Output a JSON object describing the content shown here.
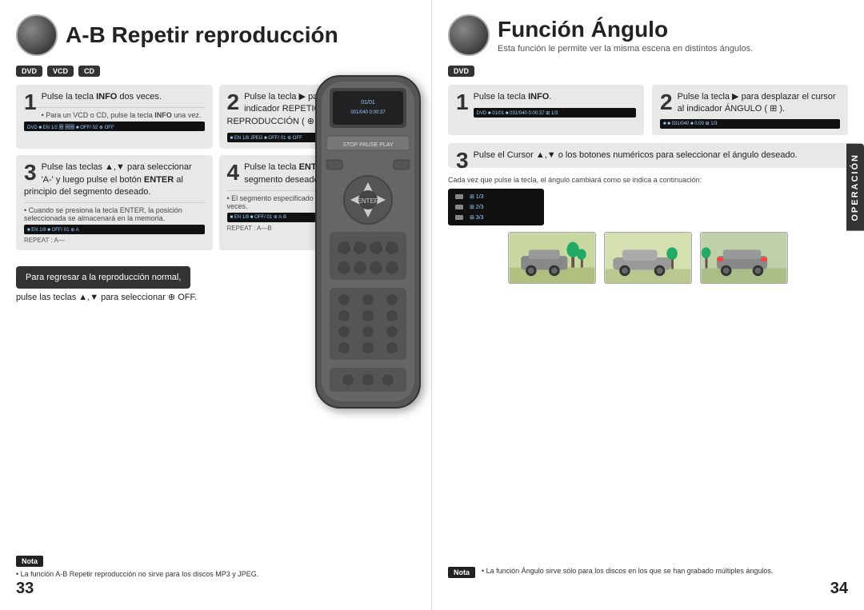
{
  "left_page": {
    "title": "A-B Repetir reproducción",
    "badges": [
      "DVD",
      "VCD",
      "CD"
    ],
    "step1": {
      "number": "1",
      "text": "Pulse la tecla INFO dos veces."
    },
    "step2": {
      "number": "2",
      "text": "Pulse la tecla ▶ para moverse al indicador REPETICIÓN DE REPRODUCCIÓN ( ⊕ )."
    },
    "step3": {
      "number": "3",
      "text": "Pulse las teclas ▲,▼ para seleccionar 'A-' y luego pulse el botón ENTER al principio del segmento deseado."
    },
    "step4": {
      "number": "4",
      "text": "Pulse la tecla ENTER al final del segmento deseado."
    },
    "step3_note": "Cuando se presiona la tecla ENTER, la posición seleccionada se almacenará en la memoria.",
    "step4_note": "El segmento especificado se reproducirá repetidas veces.",
    "return_label": "Para regresar a la reproducción normal,",
    "return_text": "pulse las teclas ▲,▼ para seleccionar ⊕ OFF.",
    "nota_label": "Nota",
    "nota_text": "• La función A-B Repetir reproducción no sirve para los discos MP3 y JPEG.",
    "page_number": "33"
  },
  "right_page": {
    "title": "Función Ángulo",
    "subtitle": "Esta función le permite ver la misma escena en distintos ángulos.",
    "badges": [
      "DVD"
    ],
    "step1": {
      "number": "1",
      "text": "Pulse la tecla INFO."
    },
    "step2": {
      "number": "2",
      "text": "Pulse la tecla ▶ para desplazar el cursor al indicador ÁNGULO ( ⊞ )."
    },
    "step3": {
      "number": "3",
      "text": "Pulse el Cursor ▲,▼ o los botones numéricos para seleccionar el ángulo deseado."
    },
    "step3_note": "Cada vez que pulse la tecla, el ángulo cambiará como se indica a continuación:",
    "nota_label": "Nota",
    "nota_text": "• La función Ángulo sirve sólo para los discos en los que se han grabado múltiples ángulos.",
    "page_number": "34",
    "operacion_label": "OPERACIÓN"
  }
}
